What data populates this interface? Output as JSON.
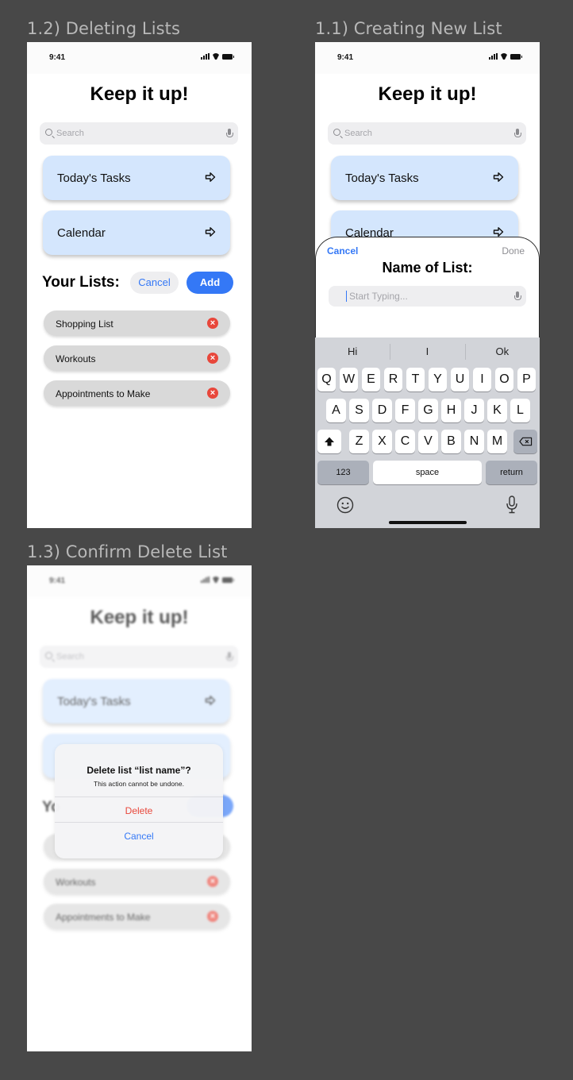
{
  "frames": {
    "deleting": {
      "title": "1.2) Deleting Lists"
    },
    "creating": {
      "title": "1.1) Creating New List"
    },
    "confirm": {
      "title": "1.3) Confirm Delete List"
    }
  },
  "status": {
    "time": "9:41"
  },
  "app": {
    "heading": "Keep it up!",
    "search_placeholder": "Search",
    "cards": [
      {
        "label": "Today's Tasks",
        "icon": "arrow-right-icon"
      },
      {
        "label": "Calendar",
        "icon": "arrow-right-icon"
      }
    ],
    "your_lists_label": "Your Lists:",
    "cancel_label": "Cancel",
    "add_label": "Add",
    "lists": [
      "Shopping List",
      "Workouts",
      "Appointments to Make"
    ]
  },
  "partial": {
    "your_lists_fragment": "Yo"
  },
  "sheet": {
    "cancel": "Cancel",
    "done": "Done",
    "title": "Name of List:",
    "placeholder": "Start Typing..."
  },
  "keyboard": {
    "predictions": [
      "Hi",
      "I",
      "Ok"
    ],
    "row1": [
      "Q",
      "W",
      "E",
      "R",
      "T",
      "Y",
      "U",
      "I",
      "O",
      "P"
    ],
    "row2": [
      "A",
      "S",
      "D",
      "F",
      "G",
      "H",
      "J",
      "K",
      "L"
    ],
    "row3": [
      "Z",
      "X",
      "C",
      "V",
      "B",
      "N",
      "M"
    ],
    "numbers": "123",
    "space": "space",
    "return": "return"
  },
  "dialog": {
    "title": "Delete list “list name”?",
    "message": "This action cannot be undone.",
    "delete": "Delete",
    "cancel": "Cancel"
  },
  "colors": {
    "accent": "#3478f6",
    "card": "#d4e6fd",
    "danger": "#e8473b",
    "pill": "#d9d9d9",
    "background": "#484848"
  }
}
